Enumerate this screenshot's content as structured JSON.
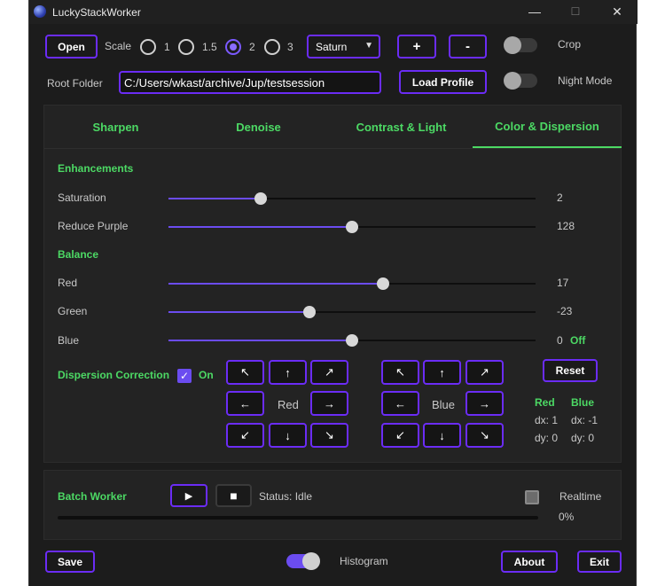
{
  "window": {
    "title": "LuckyStackWorker",
    "minimize": "—",
    "maximize": "☐",
    "close": "✕"
  },
  "toolbar": {
    "open": "Open",
    "scale_label": "Scale",
    "scale_options": [
      "1",
      "1.5",
      "2",
      "3"
    ],
    "scale_selected": "2",
    "planet": "Saturn",
    "plus": "+",
    "minus": "-",
    "crop_label": "Crop",
    "crop_on": false,
    "root_folder_label": "Root Folder",
    "root_folder": "C:/Users/wkast/archive/Jup/testsession",
    "load_profile": "Load Profile",
    "night_mode_label": "Night Mode",
    "night_mode_on": false
  },
  "tabs": [
    "Sharpen",
    "Denoise",
    "Contrast & Light",
    "Color & Dispersion"
  ],
  "active_tab": "Color & Dispersion",
  "enhancements": {
    "heading": "Enhancements",
    "saturation": {
      "label": "Saturation",
      "value": "2",
      "fraction": 0.25
    },
    "reduce_purple": {
      "label": "Reduce Purple",
      "value": "128",
      "fraction": 0.5
    }
  },
  "balance": {
    "heading": "Balance",
    "red": {
      "label": "Red",
      "value": "17",
      "fraction": 0.585
    },
    "green": {
      "label": "Green",
      "value": "-23",
      "fraction": 0.385
    },
    "blue": {
      "label": "Blue",
      "value": "0",
      "fraction": 0.5,
      "status": "Off"
    }
  },
  "dispersion": {
    "label": "Dispersion Correction",
    "checkbox_label": "On",
    "checked": true,
    "red_label": "Red",
    "blue_label": "Blue",
    "reset": "Reset",
    "red_dx": "dx: 1",
    "red_dy": "dy: 0",
    "blue_dx": "dx: -1",
    "blue_dy": "dy: 0"
  },
  "batch": {
    "label": "Batch Worker",
    "play": "▶",
    "stop": "■",
    "status": "Status: Idle",
    "realtime_label": "Realtime",
    "realtime_checked": false,
    "progress_percent": "0%",
    "progress": 0
  },
  "footer": {
    "save": "Save",
    "histogram_label": "Histogram",
    "histogram_on": true,
    "about": "About",
    "exit": "Exit"
  },
  "colors": {
    "accent_border": "#6b2cf5",
    "accent_fill": "#6b4cf0",
    "green": "#4cd964",
    "background": "#1c1c1c"
  }
}
